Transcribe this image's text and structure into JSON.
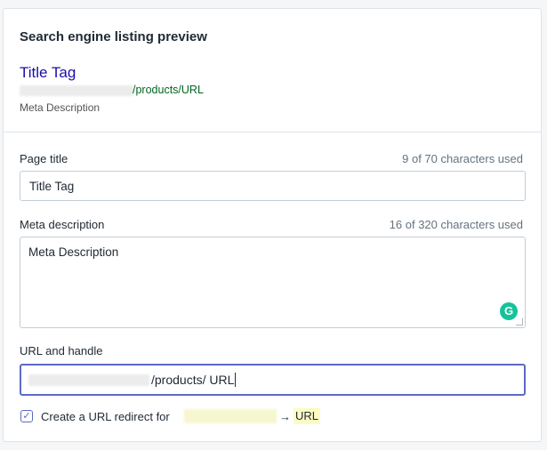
{
  "preview": {
    "heading": "Search engine listing preview",
    "title": "Title Tag",
    "url_suffix": "/products/URL",
    "description": "Meta Description"
  },
  "page_title": {
    "label": "Page title",
    "count": "9 of 70 characters used",
    "value": "Title Tag"
  },
  "meta_description": {
    "label": "Meta description",
    "count": "16 of 320 characters used",
    "value": "Meta Description",
    "grammarly_icon": "grammarly-icon"
  },
  "url_handle": {
    "label": "URL and handle",
    "value": "/products/ URL"
  },
  "redirect": {
    "checked": true,
    "label": "Create a URL redirect for",
    "arrow": "→",
    "target": "URL"
  },
  "colors": {
    "serp_title": "#1a0dab",
    "serp_url": "#006621",
    "focus_border": "#5c6ac4",
    "grammarly": "#15c39a"
  }
}
